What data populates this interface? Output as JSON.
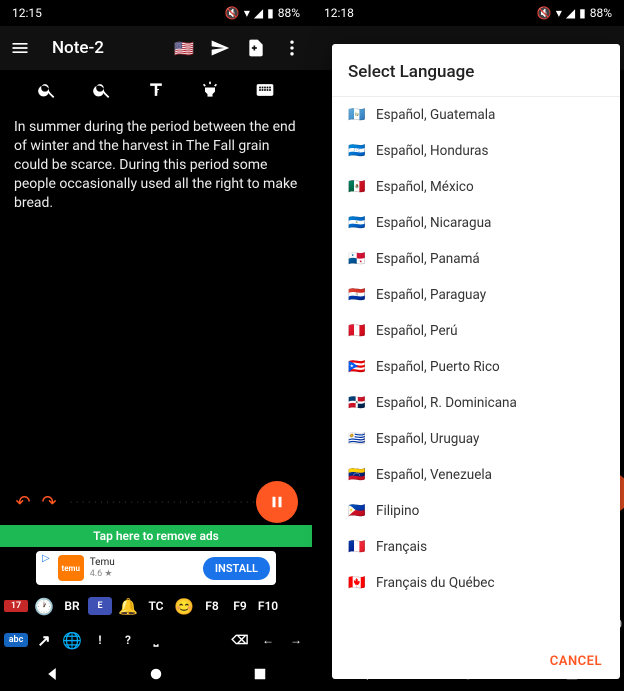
{
  "left": {
    "status": {
      "time": "12:15",
      "battery": "88%"
    },
    "appbar": {
      "title": "Note-2",
      "flag": "🇺🇸"
    },
    "editor": {
      "text": "In summer during the period between the end of winter and the harvest in The Fall grain could be scarce. During this period some people occasionally used all the right to make bread."
    },
    "adstrip": "Tap here to remove ads",
    "ad": {
      "name": "Temu",
      "rating": "4.6 ★",
      "cta": "INSTALL"
    },
    "kb_row1": [
      "BR",
      "TC",
      "F8",
      "F9",
      "F10"
    ],
    "kb_row2": [
      "!",
      "?"
    ]
  },
  "right": {
    "status": {
      "time": "12:18",
      "battery": "88%"
    },
    "dialog": {
      "title": "Select Language",
      "languages": [
        {
          "flag": "🇬🇹",
          "name": "Español, Guatemala"
        },
        {
          "flag": "🇭🇳",
          "name": "Español, Honduras"
        },
        {
          "flag": "🇲🇽",
          "name": "Español, México"
        },
        {
          "flag": "🇳🇮",
          "name": "Español, Nicaragua"
        },
        {
          "flag": "🇵🇦",
          "name": "Español, Panamá"
        },
        {
          "flag": "🇵🇾",
          "name": "Español, Paraguay"
        },
        {
          "flag": "🇵🇪",
          "name": "Español, Perú"
        },
        {
          "flag": "🇵🇷",
          "name": "Español, Puerto Rico"
        },
        {
          "flag": "🇩🇴",
          "name": "Español, R. Dominicana"
        },
        {
          "flag": "🇺🇾",
          "name": "Español, Uruguay"
        },
        {
          "flag": "🇻🇪",
          "name": "Español, Venezuela"
        },
        {
          "flag": "🇵🇭",
          "name": "Filipino"
        },
        {
          "flag": "🇫🇷",
          "name": "Français"
        },
        {
          "flag": "🇨🇦",
          "name": "Français du Québec"
        }
      ],
      "cancel": "CANCEL"
    },
    "bg_key": "10"
  }
}
